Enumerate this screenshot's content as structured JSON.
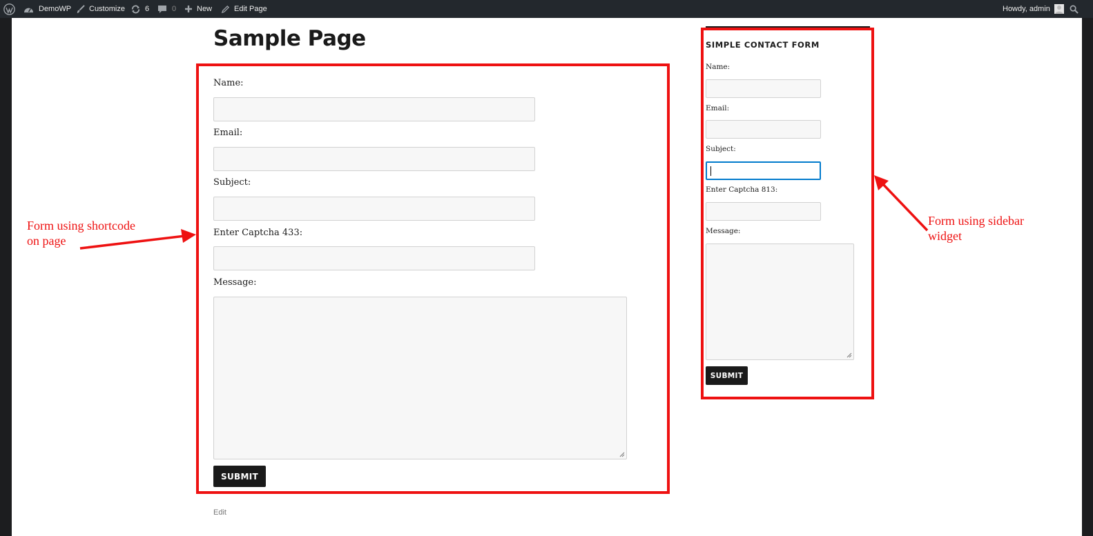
{
  "adminbar": {
    "site_name": "DemoWP",
    "customize": "Customize",
    "updates_count": "6",
    "comments_count": "0",
    "new_label": "New",
    "edit_page": "Edit Page",
    "greeting": "Howdy, admin"
  },
  "page": {
    "title": "Sample Page",
    "edit_link": "Edit"
  },
  "main_form": {
    "name_label": "Name:",
    "email_label": "Email:",
    "subject_label": "Subject:",
    "captcha_label": "Enter Captcha 433:",
    "message_label": "Message:",
    "submit_label": "SUBMIT"
  },
  "sidebar_form": {
    "title": "SIMPLE CONTACT FORM",
    "name_label": "Name:",
    "email_label": "Email:",
    "subject_label": "Subject:",
    "captcha_label": "Enter Captcha 813:",
    "message_label": "Message:",
    "submit_label": "SUBMIT"
  },
  "annotations": {
    "left_line1": "Form using shortcode",
    "left_line2": "on page",
    "right_line1": "Form using sidebar",
    "right_line2": "widget",
    "color": "#ee1111"
  },
  "icons": [
    "wordpress-icon",
    "dashboard-icon",
    "brush-icon",
    "updates-icon",
    "comment-icon",
    "plus-icon",
    "pencil-icon",
    "avatar",
    "search-icon"
  ]
}
